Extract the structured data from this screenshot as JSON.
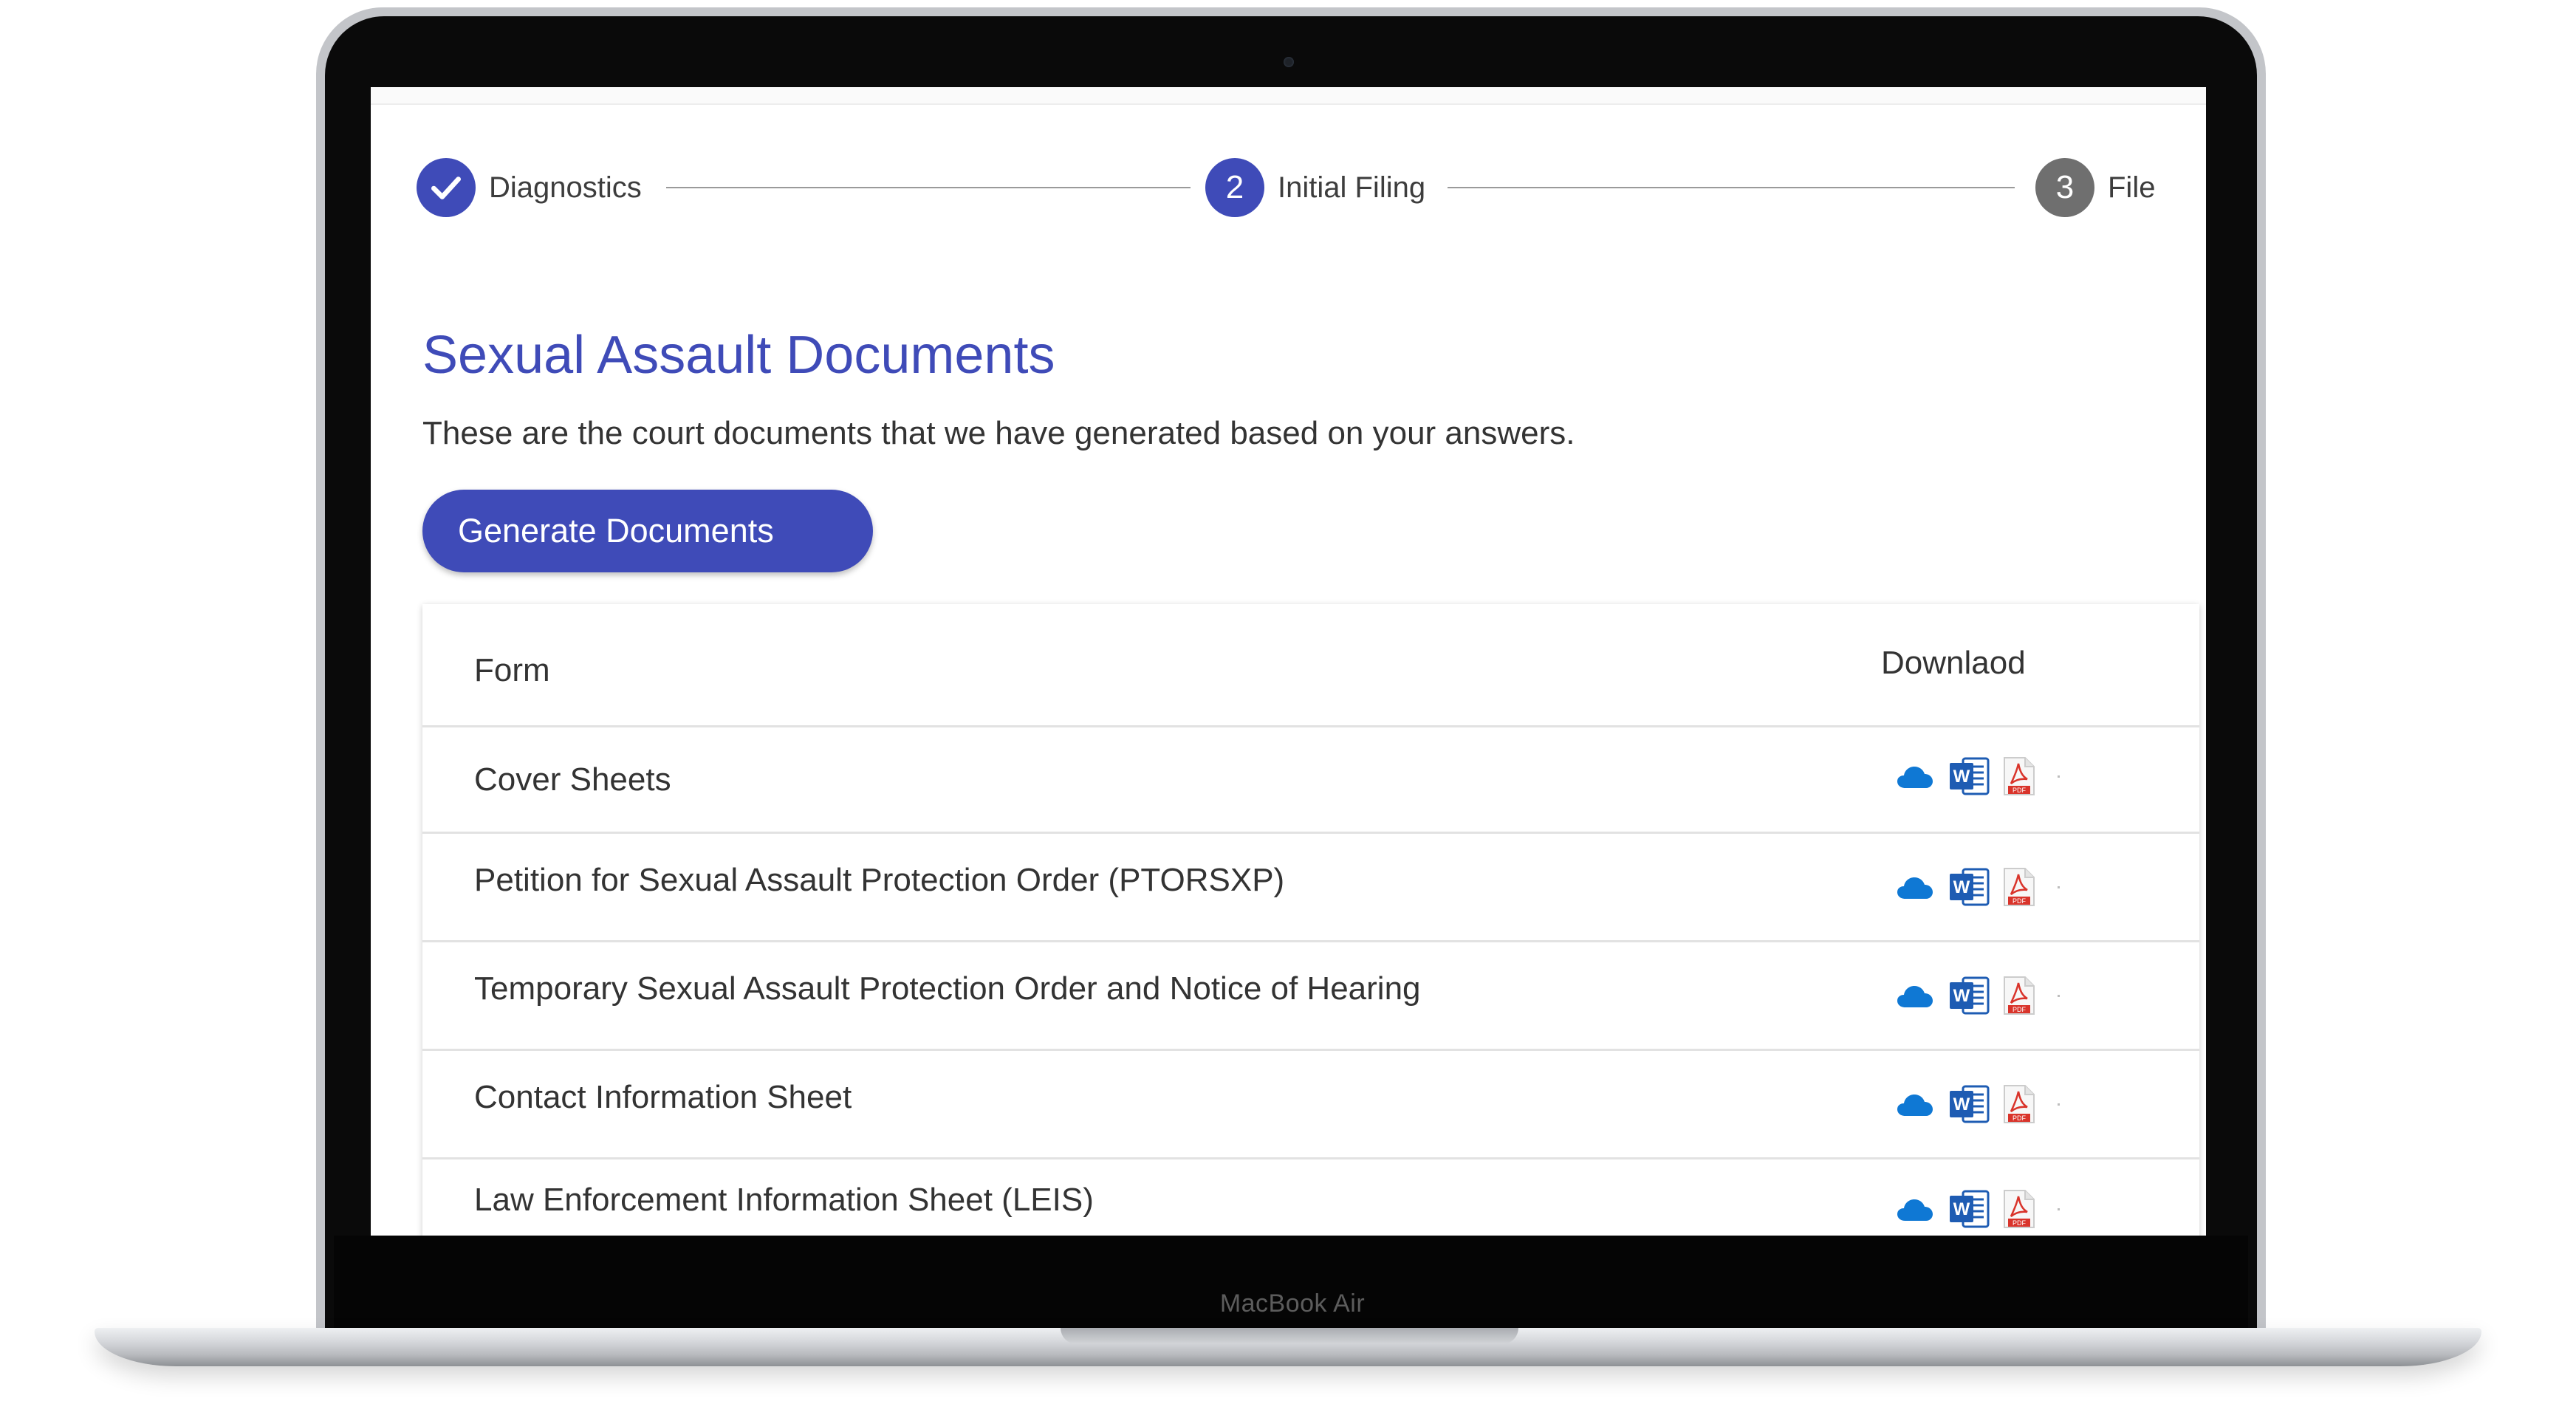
{
  "device": {
    "model_label": "MacBook Air"
  },
  "stepper": {
    "steps": [
      {
        "number": "✓",
        "label": "Diagnostics",
        "state": "done"
      },
      {
        "number": "2",
        "label": "Initial Filing",
        "state": "active"
      },
      {
        "number": "3",
        "label": "File",
        "state": "pending"
      }
    ]
  },
  "page": {
    "title": "Sexual Assault Documents",
    "subtitle": "These are the court documents that we have generated based on your answers.",
    "generate_button_label": "Generate Documents"
  },
  "table": {
    "headers": {
      "form": "Form",
      "download": "Downlaod"
    },
    "rows": [
      {
        "form": "Cover Sheets",
        "downloads": [
          "onedrive-cloud-icon",
          "word-doc-icon",
          "pdf-file-icon"
        ]
      },
      {
        "form": "Petition for Sexual Assault Protection Order (PTORSXP)",
        "downloads": [
          "onedrive-cloud-icon",
          "word-doc-icon",
          "pdf-file-icon"
        ]
      },
      {
        "form": "Temporary Sexual Assault Protection Order and Notice of Hearing",
        "downloads": [
          "onedrive-cloud-icon",
          "word-doc-icon",
          "pdf-file-icon"
        ]
      },
      {
        "form": "Contact Information Sheet",
        "downloads": [
          "onedrive-cloud-icon",
          "word-doc-icon",
          "pdf-file-icon"
        ]
      },
      {
        "form": "Law Enforcement Information Sheet (LEIS)",
        "downloads": [
          "onedrive-cloud-icon",
          "word-doc-icon",
          "pdf-file-icon"
        ]
      }
    ]
  },
  "colors": {
    "accent": "#3f4bb8",
    "step_pending": "#6f6f6f",
    "text": "#333333",
    "onedrive_blue": "#0f78d4",
    "word_blue": "#1e5cb3",
    "pdf_red": "#d9342b"
  }
}
